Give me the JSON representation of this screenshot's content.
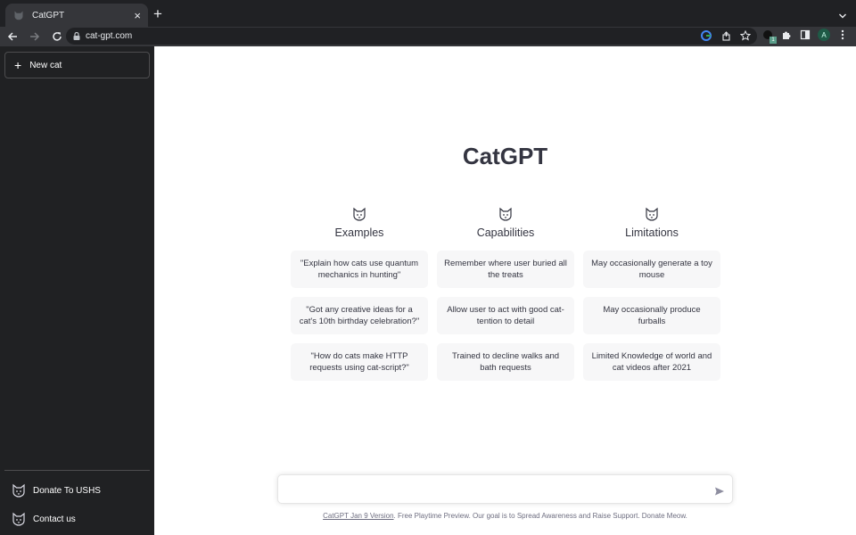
{
  "browser": {
    "tab_title": "CatGPT",
    "url": "cat-gpt.com",
    "avatar_letter": "A",
    "extension_badge": "1",
    "icons": [
      "back-icon",
      "forward-icon",
      "reload-icon",
      "lock-icon",
      "google-icon",
      "share-icon",
      "bookmark-star-icon",
      "extension-icon",
      "puzzle-icon",
      "side-panel-icon",
      "menu-icon"
    ]
  },
  "sidebar": {
    "new_button": "New cat",
    "bottom_items": [
      {
        "label": "Donate To USHS",
        "icon": "cat-icon"
      },
      {
        "label": "Contact us",
        "icon": "cat-icon"
      }
    ]
  },
  "main": {
    "title": "CatGPT",
    "columns": [
      {
        "title": "Examples",
        "icon": "cat-icon",
        "items": [
          "\"Explain how cats use quantum mechanics in hunting\"",
          "\"Got any creative ideas for a cat's 10th birthday celebration?\"",
          "\"How do cats make HTTP requests using cat-script?\""
        ]
      },
      {
        "title": "Capabilities",
        "icon": "cat-icon",
        "items": [
          "Remember where user buried all the treats",
          "Allow user to act with good cat-tention to detail",
          "Trained to decline walks and bath requests"
        ]
      },
      {
        "title": "Limitations",
        "icon": "cat-icon",
        "items": [
          "May occasionally generate a toy mouse",
          "May occasionally produce furballs",
          "Limited Knowledge of world and cat videos after 2021"
        ]
      }
    ],
    "input": {
      "value": "",
      "placeholder": ""
    },
    "footer": {
      "link": "CatGPT Jan 9 Version",
      "text": ". Free Playtime Preview. Our goal is to Spread Awareness and Raise Support. Donate Meow."
    }
  }
}
